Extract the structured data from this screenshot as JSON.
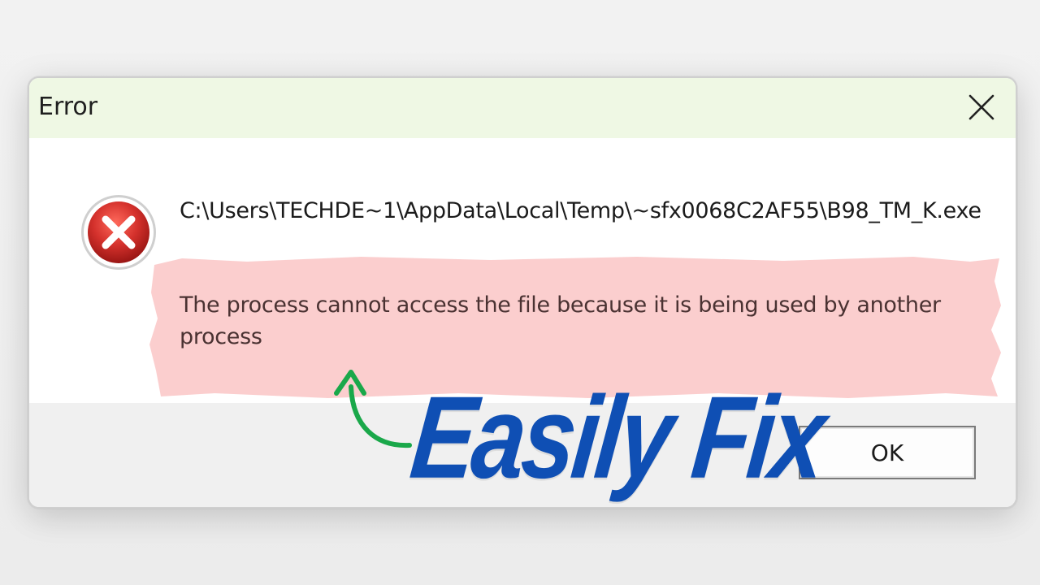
{
  "dialog": {
    "title": "Error",
    "close_icon": "close-icon",
    "error_icon": "error-x-icon",
    "path": "C:\\Users\\TECHDE~1\\AppData\\Local\\Temp\\~sfx0068C2AF55\\B98_TM_K.exe",
    "message": "The process cannot access the file because it is being used by another process",
    "ok_label": "OK"
  },
  "overlay": {
    "headline": "Easily Fix",
    "arrow_icon": "curved-arrow-icon"
  },
  "colors": {
    "titlebar_bg": "#eff8e4",
    "highlight": "#fbcaca",
    "headline": "#0f4fb4",
    "arrow": "#1aa84a",
    "error_red": "#c6282a"
  }
}
